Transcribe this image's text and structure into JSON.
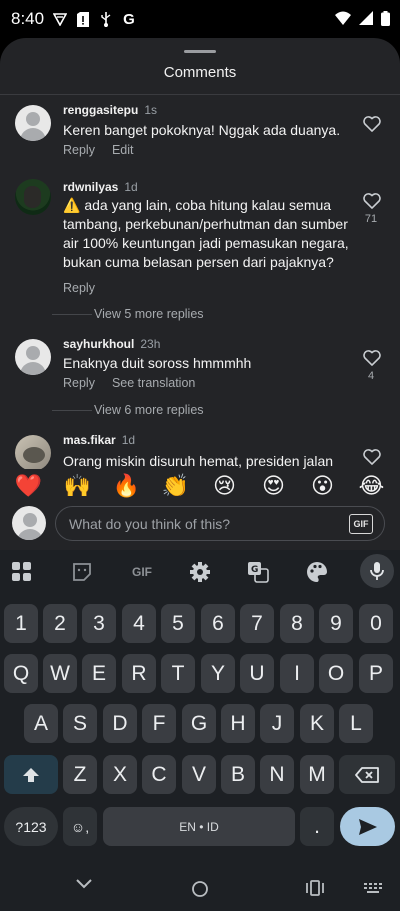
{
  "status_bar": {
    "time": "8:40",
    "icons": [
      "tiktok-icon",
      "sim-alert-icon",
      "usb-icon",
      "google-icon"
    ],
    "right_icons": [
      "wifi-icon",
      "signal-icon",
      "battery-icon"
    ]
  },
  "sheet": {
    "title": "Comments"
  },
  "comments": [
    {
      "user": "renggasitepu",
      "time": "1s",
      "text": "Keren banget pokoknya! Nggak ada duanya.",
      "actions": [
        "Reply",
        "Edit"
      ],
      "likes": ""
    },
    {
      "user": "rdwnilyas",
      "time": "1d",
      "text": "⚠️ ada yang lain, coba hitung kalau semua tambang, perkebunan/perhutman dan sumber air 100% keuntungan jadi pemasukan negara, bukan cuma belasan persen dari pajaknya?",
      "actions": [
        "Reply"
      ],
      "likes": "71",
      "view_more": "View 5 more replies"
    },
    {
      "user": "sayhurkhoul",
      "time": "23h",
      "text": "Enaknya duit soross hmmmhh",
      "actions": [
        "Reply",
        "See translation"
      ],
      "likes": "4",
      "view_more": "View 6 more replies"
    },
    {
      "user": "mas.fikar",
      "time": "1d",
      "text": "Orang miskin disuruh hemat, presiden jalan",
      "actions": [],
      "likes": ""
    }
  ],
  "emojis": [
    "❤️",
    "🙌",
    "🔥",
    "👏",
    "😢",
    "😍",
    "😮",
    "😂"
  ],
  "input": {
    "placeholder": "What do you think of this?",
    "gif_label": "GIF"
  },
  "keyboard": {
    "toolbar": [
      "apps-grid-icon",
      "sticker-icon",
      "gif-icon",
      "settings-gear-icon",
      "translate-icon",
      "palette-icon",
      "mic-icon"
    ],
    "toolbar_gif_label": "GIF",
    "row_numbers": [
      "1",
      "2",
      "3",
      "4",
      "5",
      "6",
      "7",
      "8",
      "9",
      "0"
    ],
    "row1": [
      "Q",
      "W",
      "E",
      "R",
      "T",
      "Y",
      "U",
      "I",
      "O",
      "P"
    ],
    "row2": [
      "A",
      "S",
      "D",
      "F",
      "G",
      "H",
      "J",
      "K",
      "L"
    ],
    "row3": [
      "Z",
      "X",
      "C",
      "V",
      "B",
      "N",
      "M"
    ],
    "symbols_label": "?123",
    "emoji_key": "☺,",
    "space_label": "EN • ID",
    "period": ".",
    "colors": {
      "background": "#1d2024",
      "key": "#3a3d42",
      "enter": "#a9c9e2"
    }
  },
  "nav": {
    "icons": [
      "back-chevron-icon",
      "home-icon",
      "recents-icon",
      "keyboard-switch-icon"
    ]
  },
  "colors": {
    "sheet_bg": "#232427",
    "text": "#f3f3f3",
    "muted": "#a7abaf"
  }
}
